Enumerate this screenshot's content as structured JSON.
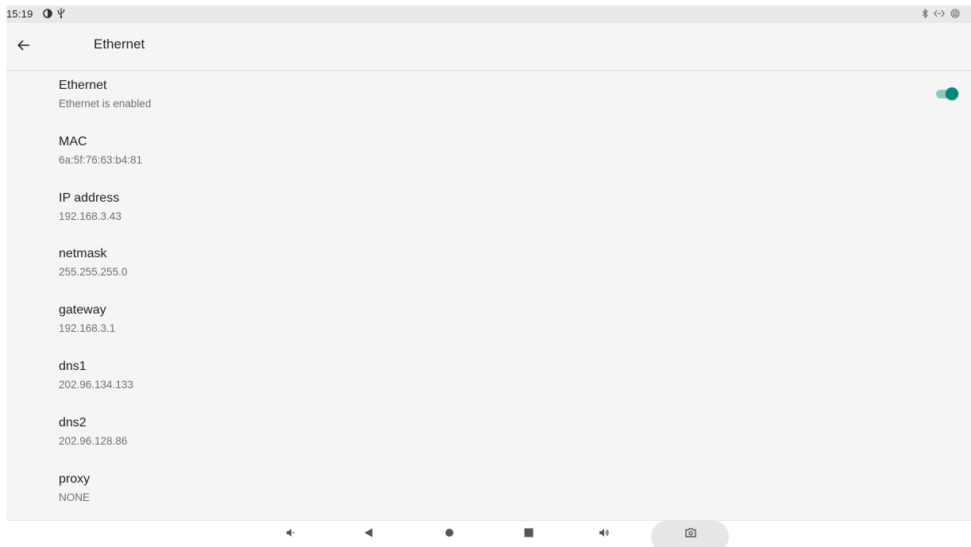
{
  "status_bar": {
    "time": "15:19",
    "left_icons": [
      "data-saver-icon",
      "usb-icon"
    ],
    "right_icons": [
      "bluetooth-icon",
      "ethernet-icon",
      "hotspot-icon"
    ]
  },
  "app_bar": {
    "title": "Ethernet"
  },
  "preferences": [
    {
      "title": "Ethernet",
      "summary": "Ethernet is enabled",
      "toggle": true
    },
    {
      "title": "MAC",
      "summary": "6a:5f:76:63:b4:81"
    },
    {
      "title": "IP address",
      "summary": "192.168.3.43"
    },
    {
      "title": "netmask",
      "summary": "255.255.255.0"
    },
    {
      "title": "gateway",
      "summary": "192.168.3.1"
    },
    {
      "title": "dns1",
      "summary": "202.96.134.133"
    },
    {
      "title": "dns2",
      "summary": "202.96.128.86"
    },
    {
      "title": "proxy",
      "summary": "NONE"
    }
  ],
  "ethernet_toggle_on": true,
  "colors": {
    "accent": "#00897b",
    "accent_track": "#8ccbc3",
    "background": "#f5f5f5"
  },
  "nav_bar": {
    "buttons": [
      "volume-down-icon",
      "back-icon",
      "home-icon",
      "recents-icon",
      "volume-up-icon",
      "screenshot-icon"
    ]
  }
}
